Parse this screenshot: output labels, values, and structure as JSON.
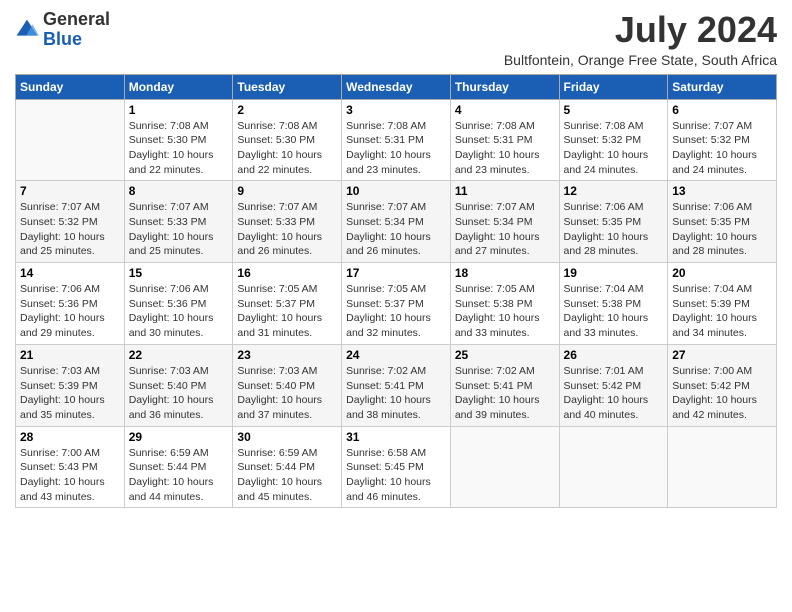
{
  "logo": {
    "text_general": "General",
    "text_blue": "Blue"
  },
  "title": "July 2024",
  "location": "Bultfontein, Orange Free State, South Africa",
  "days_of_week": [
    "Sunday",
    "Monday",
    "Tuesday",
    "Wednesday",
    "Thursday",
    "Friday",
    "Saturday"
  ],
  "weeks": [
    [
      {
        "day": "",
        "sunrise": "",
        "sunset": "",
        "daylight": ""
      },
      {
        "day": "1",
        "sunrise": "Sunrise: 7:08 AM",
        "sunset": "Sunset: 5:30 PM",
        "daylight": "Daylight: 10 hours and 22 minutes."
      },
      {
        "day": "2",
        "sunrise": "Sunrise: 7:08 AM",
        "sunset": "Sunset: 5:30 PM",
        "daylight": "Daylight: 10 hours and 22 minutes."
      },
      {
        "day": "3",
        "sunrise": "Sunrise: 7:08 AM",
        "sunset": "Sunset: 5:31 PM",
        "daylight": "Daylight: 10 hours and 23 minutes."
      },
      {
        "day": "4",
        "sunrise": "Sunrise: 7:08 AM",
        "sunset": "Sunset: 5:31 PM",
        "daylight": "Daylight: 10 hours and 23 minutes."
      },
      {
        "day": "5",
        "sunrise": "Sunrise: 7:08 AM",
        "sunset": "Sunset: 5:32 PM",
        "daylight": "Daylight: 10 hours and 24 minutes."
      },
      {
        "day": "6",
        "sunrise": "Sunrise: 7:07 AM",
        "sunset": "Sunset: 5:32 PM",
        "daylight": "Daylight: 10 hours and 24 minutes."
      }
    ],
    [
      {
        "day": "7",
        "sunrise": "Sunrise: 7:07 AM",
        "sunset": "Sunset: 5:32 PM",
        "daylight": "Daylight: 10 hours and 25 minutes."
      },
      {
        "day": "8",
        "sunrise": "Sunrise: 7:07 AM",
        "sunset": "Sunset: 5:33 PM",
        "daylight": "Daylight: 10 hours and 25 minutes."
      },
      {
        "day": "9",
        "sunrise": "Sunrise: 7:07 AM",
        "sunset": "Sunset: 5:33 PM",
        "daylight": "Daylight: 10 hours and 26 minutes."
      },
      {
        "day": "10",
        "sunrise": "Sunrise: 7:07 AM",
        "sunset": "Sunset: 5:34 PM",
        "daylight": "Daylight: 10 hours and 26 minutes."
      },
      {
        "day": "11",
        "sunrise": "Sunrise: 7:07 AM",
        "sunset": "Sunset: 5:34 PM",
        "daylight": "Daylight: 10 hours and 27 minutes."
      },
      {
        "day": "12",
        "sunrise": "Sunrise: 7:06 AM",
        "sunset": "Sunset: 5:35 PM",
        "daylight": "Daylight: 10 hours and 28 minutes."
      },
      {
        "day": "13",
        "sunrise": "Sunrise: 7:06 AM",
        "sunset": "Sunset: 5:35 PM",
        "daylight": "Daylight: 10 hours and 28 minutes."
      }
    ],
    [
      {
        "day": "14",
        "sunrise": "Sunrise: 7:06 AM",
        "sunset": "Sunset: 5:36 PM",
        "daylight": "Daylight: 10 hours and 29 minutes."
      },
      {
        "day": "15",
        "sunrise": "Sunrise: 7:06 AM",
        "sunset": "Sunset: 5:36 PM",
        "daylight": "Daylight: 10 hours and 30 minutes."
      },
      {
        "day": "16",
        "sunrise": "Sunrise: 7:05 AM",
        "sunset": "Sunset: 5:37 PM",
        "daylight": "Daylight: 10 hours and 31 minutes."
      },
      {
        "day": "17",
        "sunrise": "Sunrise: 7:05 AM",
        "sunset": "Sunset: 5:37 PM",
        "daylight": "Daylight: 10 hours and 32 minutes."
      },
      {
        "day": "18",
        "sunrise": "Sunrise: 7:05 AM",
        "sunset": "Sunset: 5:38 PM",
        "daylight": "Daylight: 10 hours and 33 minutes."
      },
      {
        "day": "19",
        "sunrise": "Sunrise: 7:04 AM",
        "sunset": "Sunset: 5:38 PM",
        "daylight": "Daylight: 10 hours and 33 minutes."
      },
      {
        "day": "20",
        "sunrise": "Sunrise: 7:04 AM",
        "sunset": "Sunset: 5:39 PM",
        "daylight": "Daylight: 10 hours and 34 minutes."
      }
    ],
    [
      {
        "day": "21",
        "sunrise": "Sunrise: 7:03 AM",
        "sunset": "Sunset: 5:39 PM",
        "daylight": "Daylight: 10 hours and 35 minutes."
      },
      {
        "day": "22",
        "sunrise": "Sunrise: 7:03 AM",
        "sunset": "Sunset: 5:40 PM",
        "daylight": "Daylight: 10 hours and 36 minutes."
      },
      {
        "day": "23",
        "sunrise": "Sunrise: 7:03 AM",
        "sunset": "Sunset: 5:40 PM",
        "daylight": "Daylight: 10 hours and 37 minutes."
      },
      {
        "day": "24",
        "sunrise": "Sunrise: 7:02 AM",
        "sunset": "Sunset: 5:41 PM",
        "daylight": "Daylight: 10 hours and 38 minutes."
      },
      {
        "day": "25",
        "sunrise": "Sunrise: 7:02 AM",
        "sunset": "Sunset: 5:41 PM",
        "daylight": "Daylight: 10 hours and 39 minutes."
      },
      {
        "day": "26",
        "sunrise": "Sunrise: 7:01 AM",
        "sunset": "Sunset: 5:42 PM",
        "daylight": "Daylight: 10 hours and 40 minutes."
      },
      {
        "day": "27",
        "sunrise": "Sunrise: 7:00 AM",
        "sunset": "Sunset: 5:42 PM",
        "daylight": "Daylight: 10 hours and 42 minutes."
      }
    ],
    [
      {
        "day": "28",
        "sunrise": "Sunrise: 7:00 AM",
        "sunset": "Sunset: 5:43 PM",
        "daylight": "Daylight: 10 hours and 43 minutes."
      },
      {
        "day": "29",
        "sunrise": "Sunrise: 6:59 AM",
        "sunset": "Sunset: 5:44 PM",
        "daylight": "Daylight: 10 hours and 44 minutes."
      },
      {
        "day": "30",
        "sunrise": "Sunrise: 6:59 AM",
        "sunset": "Sunset: 5:44 PM",
        "daylight": "Daylight: 10 hours and 45 minutes."
      },
      {
        "day": "31",
        "sunrise": "Sunrise: 6:58 AM",
        "sunset": "Sunset: 5:45 PM",
        "daylight": "Daylight: 10 hours and 46 minutes."
      },
      {
        "day": "",
        "sunrise": "",
        "sunset": "",
        "daylight": ""
      },
      {
        "day": "",
        "sunrise": "",
        "sunset": "",
        "daylight": ""
      },
      {
        "day": "",
        "sunrise": "",
        "sunset": "",
        "daylight": ""
      }
    ]
  ]
}
